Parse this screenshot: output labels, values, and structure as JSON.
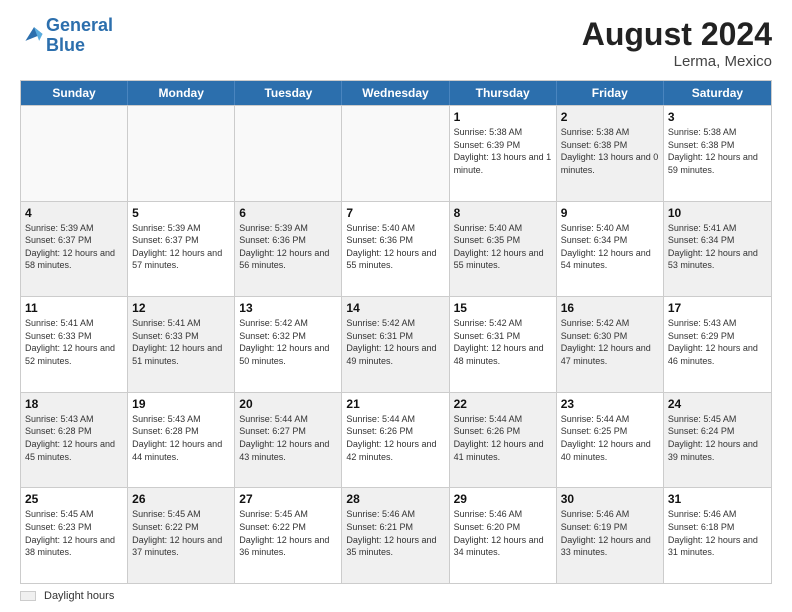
{
  "header": {
    "logo_line1": "General",
    "logo_line2": "Blue",
    "month_year": "August 2024",
    "location": "Lerma, Mexico"
  },
  "calendar": {
    "days_of_week": [
      "Sunday",
      "Monday",
      "Tuesday",
      "Wednesday",
      "Thursday",
      "Friday",
      "Saturday"
    ],
    "footer_label": "Daylight hours",
    "weeks": [
      [
        {
          "day": "",
          "info": "",
          "empty": true
        },
        {
          "day": "",
          "info": "",
          "empty": true
        },
        {
          "day": "",
          "info": "",
          "empty": true
        },
        {
          "day": "",
          "info": "",
          "empty": true
        },
        {
          "day": "1",
          "info": "Sunrise: 5:38 AM\nSunset: 6:39 PM\nDaylight: 13 hours\nand 1 minute.",
          "empty": false
        },
        {
          "day": "2",
          "info": "Sunrise: 5:38 AM\nSunset: 6:38 PM\nDaylight: 13 hours\nand 0 minutes.",
          "empty": false,
          "shaded": true
        },
        {
          "day": "3",
          "info": "Sunrise: 5:38 AM\nSunset: 6:38 PM\nDaylight: 12 hours\nand 59 minutes.",
          "empty": false
        }
      ],
      [
        {
          "day": "4",
          "info": "Sunrise: 5:39 AM\nSunset: 6:37 PM\nDaylight: 12 hours\nand 58 minutes.",
          "empty": false,
          "shaded": true
        },
        {
          "day": "5",
          "info": "Sunrise: 5:39 AM\nSunset: 6:37 PM\nDaylight: 12 hours\nand 57 minutes.",
          "empty": false
        },
        {
          "day": "6",
          "info": "Sunrise: 5:39 AM\nSunset: 6:36 PM\nDaylight: 12 hours\nand 56 minutes.",
          "empty": false,
          "shaded": true
        },
        {
          "day": "7",
          "info": "Sunrise: 5:40 AM\nSunset: 6:36 PM\nDaylight: 12 hours\nand 55 minutes.",
          "empty": false
        },
        {
          "day": "8",
          "info": "Sunrise: 5:40 AM\nSunset: 6:35 PM\nDaylight: 12 hours\nand 55 minutes.",
          "empty": false,
          "shaded": true
        },
        {
          "day": "9",
          "info": "Sunrise: 5:40 AM\nSunset: 6:34 PM\nDaylight: 12 hours\nand 54 minutes.",
          "empty": false
        },
        {
          "day": "10",
          "info": "Sunrise: 5:41 AM\nSunset: 6:34 PM\nDaylight: 12 hours\nand 53 minutes.",
          "empty": false,
          "shaded": true
        }
      ],
      [
        {
          "day": "11",
          "info": "Sunrise: 5:41 AM\nSunset: 6:33 PM\nDaylight: 12 hours\nand 52 minutes.",
          "empty": false
        },
        {
          "day": "12",
          "info": "Sunrise: 5:41 AM\nSunset: 6:33 PM\nDaylight: 12 hours\nand 51 minutes.",
          "empty": false,
          "shaded": true
        },
        {
          "day": "13",
          "info": "Sunrise: 5:42 AM\nSunset: 6:32 PM\nDaylight: 12 hours\nand 50 minutes.",
          "empty": false
        },
        {
          "day": "14",
          "info": "Sunrise: 5:42 AM\nSunset: 6:31 PM\nDaylight: 12 hours\nand 49 minutes.",
          "empty": false,
          "shaded": true
        },
        {
          "day": "15",
          "info": "Sunrise: 5:42 AM\nSunset: 6:31 PM\nDaylight: 12 hours\nand 48 minutes.",
          "empty": false
        },
        {
          "day": "16",
          "info": "Sunrise: 5:42 AM\nSunset: 6:30 PM\nDaylight: 12 hours\nand 47 minutes.",
          "empty": false,
          "shaded": true
        },
        {
          "day": "17",
          "info": "Sunrise: 5:43 AM\nSunset: 6:29 PM\nDaylight: 12 hours\nand 46 minutes.",
          "empty": false
        }
      ],
      [
        {
          "day": "18",
          "info": "Sunrise: 5:43 AM\nSunset: 6:28 PM\nDaylight: 12 hours\nand 45 minutes.",
          "empty": false,
          "shaded": true
        },
        {
          "day": "19",
          "info": "Sunrise: 5:43 AM\nSunset: 6:28 PM\nDaylight: 12 hours\nand 44 minutes.",
          "empty": false
        },
        {
          "day": "20",
          "info": "Sunrise: 5:44 AM\nSunset: 6:27 PM\nDaylight: 12 hours\nand 43 minutes.",
          "empty": false,
          "shaded": true
        },
        {
          "day": "21",
          "info": "Sunrise: 5:44 AM\nSunset: 6:26 PM\nDaylight: 12 hours\nand 42 minutes.",
          "empty": false
        },
        {
          "day": "22",
          "info": "Sunrise: 5:44 AM\nSunset: 6:26 PM\nDaylight: 12 hours\nand 41 minutes.",
          "empty": false,
          "shaded": true
        },
        {
          "day": "23",
          "info": "Sunrise: 5:44 AM\nSunset: 6:25 PM\nDaylight: 12 hours\nand 40 minutes.",
          "empty": false
        },
        {
          "day": "24",
          "info": "Sunrise: 5:45 AM\nSunset: 6:24 PM\nDaylight: 12 hours\nand 39 minutes.",
          "empty": false,
          "shaded": true
        }
      ],
      [
        {
          "day": "25",
          "info": "Sunrise: 5:45 AM\nSunset: 6:23 PM\nDaylight: 12 hours\nand 38 minutes.",
          "empty": false
        },
        {
          "day": "26",
          "info": "Sunrise: 5:45 AM\nSunset: 6:22 PM\nDaylight: 12 hours\nand 37 minutes.",
          "empty": false,
          "shaded": true
        },
        {
          "day": "27",
          "info": "Sunrise: 5:45 AM\nSunset: 6:22 PM\nDaylight: 12 hours\nand 36 minutes.",
          "empty": false
        },
        {
          "day": "28",
          "info": "Sunrise: 5:46 AM\nSunset: 6:21 PM\nDaylight: 12 hours\nand 35 minutes.",
          "empty": false,
          "shaded": true
        },
        {
          "day": "29",
          "info": "Sunrise: 5:46 AM\nSunset: 6:20 PM\nDaylight: 12 hours\nand 34 minutes.",
          "empty": false
        },
        {
          "day": "30",
          "info": "Sunrise: 5:46 AM\nSunset: 6:19 PM\nDaylight: 12 hours\nand 33 minutes.",
          "empty": false,
          "shaded": true
        },
        {
          "day": "31",
          "info": "Sunrise: 5:46 AM\nSunset: 6:18 PM\nDaylight: 12 hours\nand 31 minutes.",
          "empty": false
        }
      ]
    ]
  }
}
